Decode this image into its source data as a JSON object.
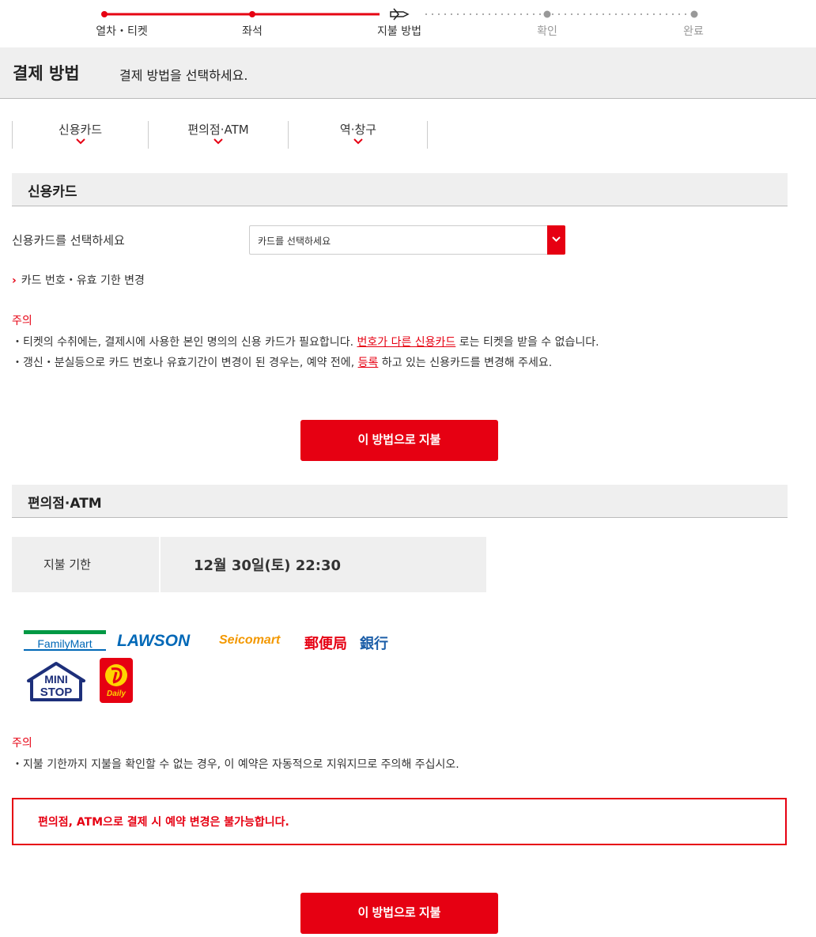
{
  "progress": {
    "steps": [
      {
        "label": "열차・티켓",
        "state": "done"
      },
      {
        "label": "좌석",
        "state": "done"
      },
      {
        "label": "지불 방법",
        "state": "current"
      },
      {
        "label": "확인",
        "state": "todo"
      },
      {
        "label": "완료",
        "state": "todo"
      }
    ]
  },
  "header": {
    "title": "결제 방법",
    "subtitle": "결제 방법을 선택하세요."
  },
  "tabs": [
    {
      "label": "신용카드"
    },
    {
      "label": "편의점·ATM"
    },
    {
      "label": "역·창구"
    }
  ],
  "credit": {
    "heading": "신용카드",
    "select_label": "신용카드를 선택하세요",
    "select_value": "카드를 선택하세요",
    "change_link": "카드 번호・유효 기한 변경",
    "notice_title": "주의",
    "notice_1_pre": "・티켓의 수취에는, 결제시에 사용한 본인 명의의 신용 카드가 필요합니다. ",
    "notice_1_link": "번호가 다른 신용카드",
    "notice_1_post": " 로는 티켓을 받을 수 없습니다.",
    "notice_2_pre": "・갱신・분실등으로 카드 번호나 유효기간이 변경이 된 경우는, 예약 전에, ",
    "notice_2_link": "등록",
    "notice_2_post": " 하고 있는 신용카드를 변경해 주세요.",
    "pay_button": "이 방법으로 지불"
  },
  "store": {
    "heading": "편의점·ATM",
    "deadline_label": "지불 기한",
    "deadline_value": "12월 30일(토) 22:30",
    "logos": {
      "familymart": "FamilyMart",
      "lawson": "LAWSON",
      "seicomart": "Seicomart",
      "post": "郵便局",
      "bank": "銀行",
      "ministop_1": "MINI",
      "ministop_2": "STOP",
      "daily": "Daily"
    },
    "notice_title": "주의",
    "notice_1": "・지불 기한까지 지불을 확인할 수 없는 경우, 이 예약은 자동적으로 지워지므로 주의해 주십시오.",
    "warning": "편의점, ATM으로 결제 시 예약 변경은 불가능합니다.",
    "pay_button": "이 방법으로 지불"
  },
  "colors": {
    "accent": "#e60012",
    "band": "#efefef",
    "step_todo": "#999999"
  }
}
